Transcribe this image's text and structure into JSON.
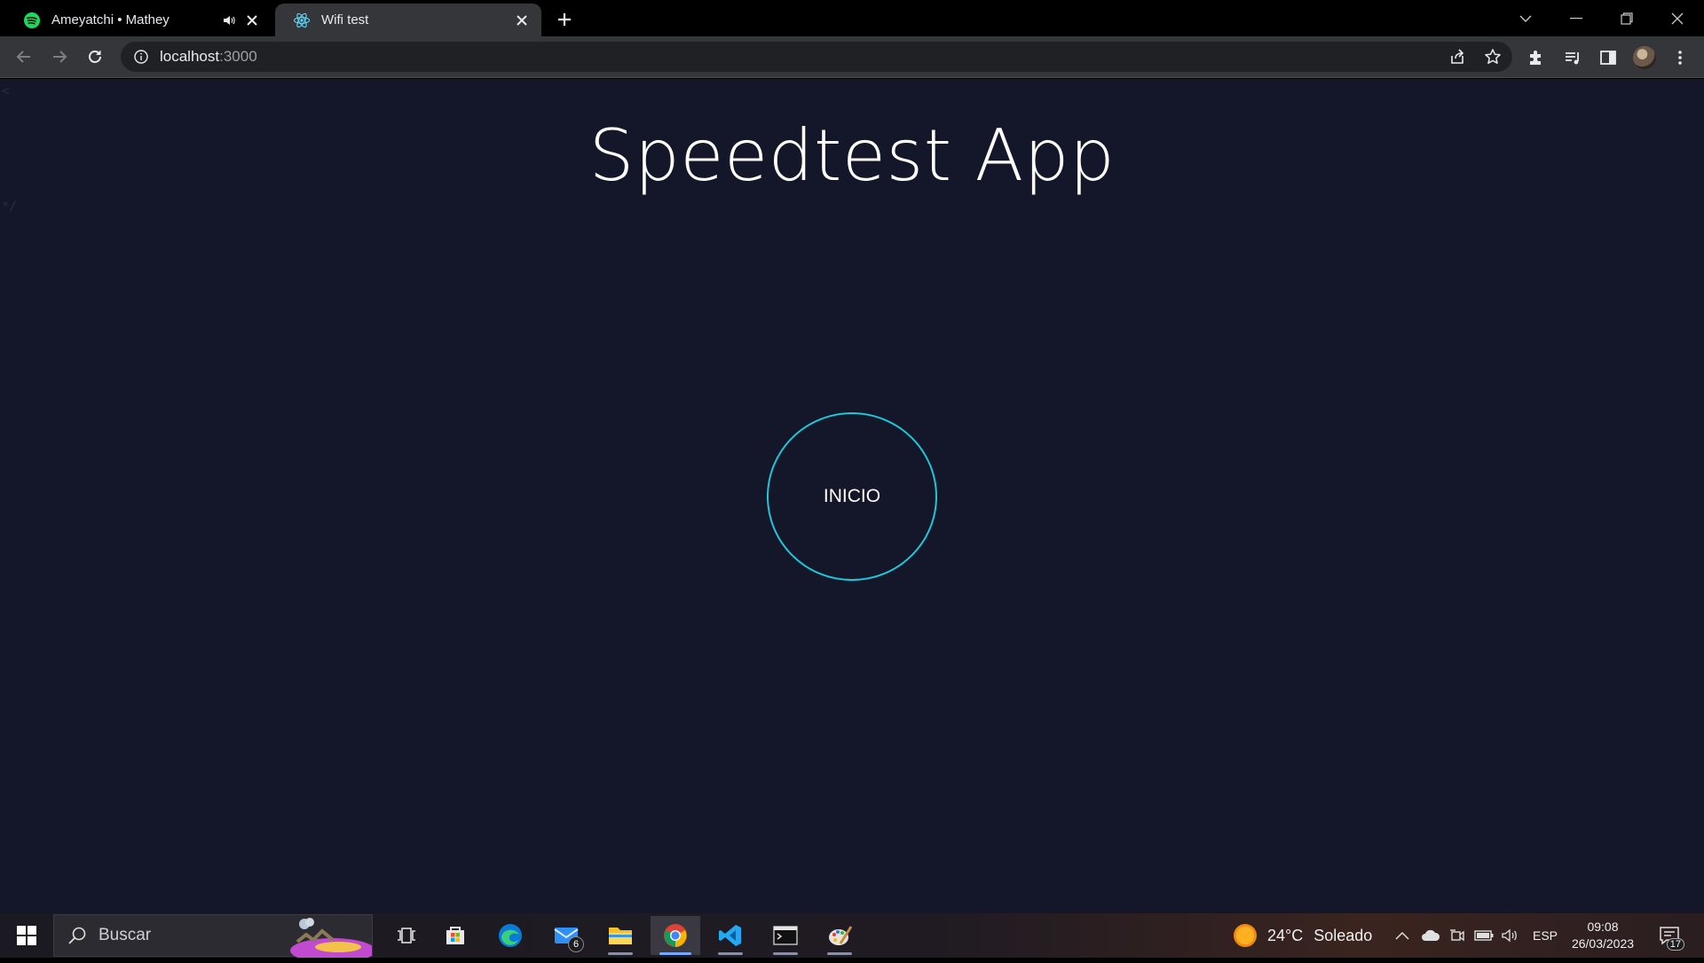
{
  "browser": {
    "tabs": [
      {
        "title": "Ameyatchi • Mathey",
        "favicon": "spotify-icon",
        "audio": "speaker-icon",
        "active": false
      },
      {
        "title": "Wifi test",
        "favicon": "react-icon",
        "active": true
      }
    ],
    "address": {
      "host": "localhost",
      "port": ":3000"
    }
  },
  "page": {
    "stray_top": "<",
    "stray_bottom": "*/",
    "title": "Speedtest App",
    "start_button": "INICIO"
  },
  "taskbar": {
    "search_placeholder": "Buscar",
    "mail_badge": "6",
    "weather": {
      "temp": "24°C",
      "condition": "Soleado"
    },
    "language": "ESP",
    "time": "09:08",
    "date": "26/03/2023",
    "notifications": "17"
  },
  "colors": {
    "page_bg": "#14162a",
    "accent": "#1ec8d8",
    "toolbar": "#35363a",
    "tabstrip": "#000000"
  }
}
